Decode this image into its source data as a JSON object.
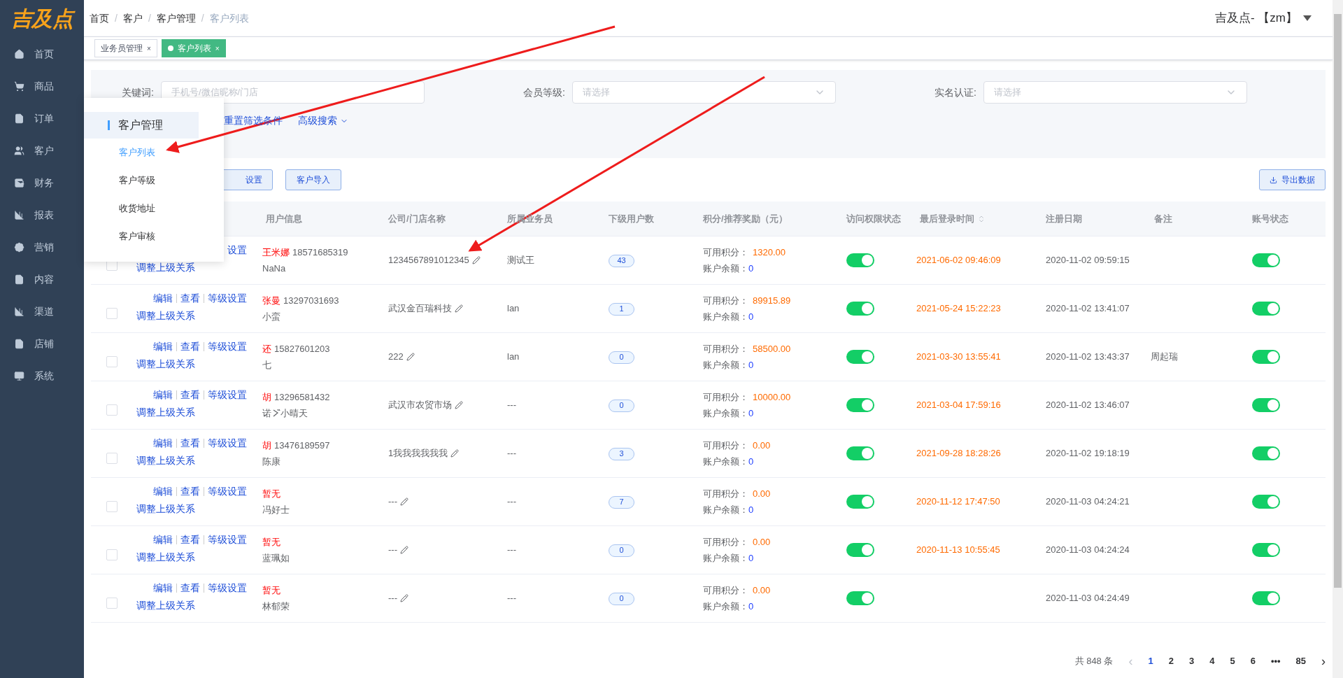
{
  "sidebar": {
    "logo": "吉及点",
    "items": [
      {
        "label": "首页"
      },
      {
        "label": "商品"
      },
      {
        "label": "订单"
      },
      {
        "label": "客户"
      },
      {
        "label": "财务"
      },
      {
        "label": "报表"
      },
      {
        "label": "营销"
      },
      {
        "label": "内容"
      },
      {
        "label": "渠道"
      },
      {
        "label": "店铺"
      },
      {
        "label": "系统"
      }
    ]
  },
  "breadcrumb": [
    {
      "label": "首页",
      "current": false
    },
    {
      "separator": "/",
      "label": "客户",
      "current": false
    },
    {
      "separator": "/",
      "label": "客户管理",
      "current": false
    },
    {
      "separator": "/",
      "label": "客户列表",
      "current": true
    }
  ],
  "user_menu": "吉及点- 【zm】",
  "tags": [
    {
      "label": "业务员管理",
      "selected": false,
      "close": "×"
    },
    {
      "label": "客户列表",
      "selected": true,
      "close": "×"
    }
  ],
  "filters": [
    {
      "label": "关键词:",
      "kind": "input",
      "placeholder": "手机号/微信昵称/门店"
    },
    {
      "label": "会员等级:",
      "kind": "select",
      "placeholder": "请选择"
    },
    {
      "label": "实名认证:",
      "kind": "select",
      "placeholder": "请选择"
    }
  ],
  "filter_links": [
    "重置筛选条件",
    "高级搜索"
  ],
  "toolbar": {
    "buttons": [
      "设置",
      "客户导入"
    ],
    "export": "导出数据"
  },
  "popup_menu": {
    "title": "客户管理",
    "items": [
      {
        "label": "客户列表",
        "selected": true
      },
      {
        "label": "客户等级",
        "selected": false
      },
      {
        "label": "收货地址",
        "selected": false
      },
      {
        "label": "客户审核",
        "selected": false
      }
    ]
  },
  "table": {
    "columns": [
      {
        "label": "用户信息",
        "sortable": false
      },
      {
        "label": "公司/门店名称",
        "sortable": false
      },
      {
        "label": "所属业务员",
        "sortable": false
      },
      {
        "label": "下级用户数",
        "sortable": false
      },
      {
        "label": "积分/推荐奖励（元）",
        "sortable": false
      },
      {
        "label": "访问权限状态",
        "sortable": false
      },
      {
        "label": "最后登录时间",
        "sortable": true
      },
      {
        "label": "注册日期",
        "sortable": false
      },
      {
        "label": "备注",
        "sortable": false
      },
      {
        "label": "账号状态",
        "sortable": false
      }
    ],
    "rows": [
      {
        "checked": false,
        "actions": [
          "设置"
        ],
        "relation": "调整上级关系",
        "name": "王米娜",
        "phone": "18571685319",
        "points_label": "可用积分：",
        "balance_label": "账户余额：",
        "nickname": "NaNa",
        "company": "1234567891012345",
        "salesperson": "测试王",
        "subordinates": "43",
        "points": "1320.00",
        "balance": "0",
        "access": true,
        "last_login": "2021-06-02 09:46:09",
        "registered": "2020-11-02 09:59:15",
        "remark": "",
        "account": true
      },
      {
        "checked": false,
        "actions": [
          "编辑",
          "查看",
          "等级设置"
        ],
        "relation": "调整上级关系",
        "name": "张曼",
        "phone": "13297031693",
        "points_label": "可用积分：",
        "balance_label": "账户余额：",
        "nickname": "小蛮",
        "company": "武汉金百瑞科技",
        "salesperson": "lan",
        "subordinates": "1",
        "points": "89915.89",
        "balance": "0",
        "access": true,
        "last_login": "2021-05-24 15:22:23",
        "registered": "2020-11-02 13:41:07",
        "remark": "",
        "account": true
      },
      {
        "checked": false,
        "actions": [
          "编辑",
          "查看",
          "等级设置"
        ],
        "relation": "调整上级关系",
        "name": "还",
        "phone": "15827601203",
        "points_label": "可用积分：",
        "balance_label": "账户余额：",
        "nickname": "七",
        "company": "222",
        "salesperson": "lan",
        "subordinates": "0",
        "points": "58500.00",
        "balance": "0",
        "access": true,
        "last_login": "2021-03-30 13:55:41",
        "registered": "2020-11-02 13:43:37",
        "remark": "周起瑞",
        "account": true
      },
      {
        "checked": false,
        "actions": [
          "编辑",
          "查看",
          "等级设置"
        ],
        "relation": "调整上级关系",
        "name": "胡",
        "phone": "13296581432",
        "points_label": "可用积分：",
        "balance_label": "账户余额：",
        "nickname": [
          {
            "kind": "text",
            "text": "诺"
          },
          {
            "kind": "mark"
          },
          {
            "kind": "text",
            "text": "小晴天"
          }
        ],
        "company": "武汉市农贸市场",
        "salesperson": "---",
        "subordinates": "0",
        "points": "10000.00",
        "balance": "0",
        "access": true,
        "last_login": "2021-03-04 17:59:16",
        "registered": "2020-11-02 13:46:07",
        "remark": "",
        "account": true
      },
      {
        "checked": false,
        "actions": [
          "编辑",
          "查看",
          "等级设置"
        ],
        "relation": "调整上级关系",
        "name": "胡",
        "phone": "13476189597",
        "points_label": "可用积分：",
        "balance_label": "账户余额：",
        "nickname": "陈康",
        "company": "1我我我我我我",
        "salesperson": "---",
        "subordinates": "3",
        "points": "0.00",
        "balance": "0",
        "access": true,
        "last_login": "2021-09-28 18:28:26",
        "registered": "2020-11-02 19:18:19",
        "remark": "",
        "account": true
      },
      {
        "checked": false,
        "actions": [
          "编辑",
          "查看",
          "等级设置"
        ],
        "relation": "调整上级关系",
        "name": "暂无",
        "phone": "",
        "points_label": "可用积分：",
        "balance_label": "账户余额：",
        "nickname": "冯好士",
        "company": "---",
        "salesperson": "---",
        "subordinates": "7",
        "points": "0.00",
        "balance": "0",
        "access": true,
        "last_login": "2020-11-12 17:47:50",
        "registered": "2020-11-03 04:24:21",
        "remark": "",
        "account": true
      },
      {
        "checked": false,
        "actions": [
          "编辑",
          "查看",
          "等级设置"
        ],
        "relation": "调整上级关系",
        "name": "暂无",
        "phone": "",
        "points_label": "可用积分：",
        "balance_label": "账户余额：",
        "nickname": "蓝珮如",
        "company": "---",
        "salesperson": "---",
        "subordinates": "0",
        "points": "0.00",
        "balance": "0",
        "access": true,
        "last_login": "2020-11-13 10:55:45",
        "registered": "2020-11-03 04:24:24",
        "remark": "",
        "account": true
      },
      {
        "checked": false,
        "actions": [
          "编辑",
          "查看",
          "等级设置"
        ],
        "relation": "调整上级关系",
        "name": "暂无",
        "phone": "",
        "points_label": "可用积分：",
        "balance_label": "账户余额：",
        "nickname": "林郁荣",
        "company": "---",
        "salesperson": "---",
        "subordinates": "0",
        "points": "0.00",
        "balance": "0",
        "access": true,
        "last_login": "",
        "registered": "2020-11-03 04:24:49",
        "remark": "",
        "account": true
      }
    ]
  },
  "pagination": {
    "total": "共 848 条",
    "prev": "‹",
    "next": "›",
    "pages": [
      {
        "label": "1",
        "selected": true
      },
      {
        "label": "2",
        "selected": false
      },
      {
        "label": "3",
        "selected": false
      },
      {
        "label": "4",
        "selected": false
      },
      {
        "label": "5",
        "selected": false
      },
      {
        "label": "6",
        "selected": false
      },
      {
        "label": "•••",
        "selected": false
      },
      {
        "label": "85",
        "selected": false
      }
    ]
  }
}
